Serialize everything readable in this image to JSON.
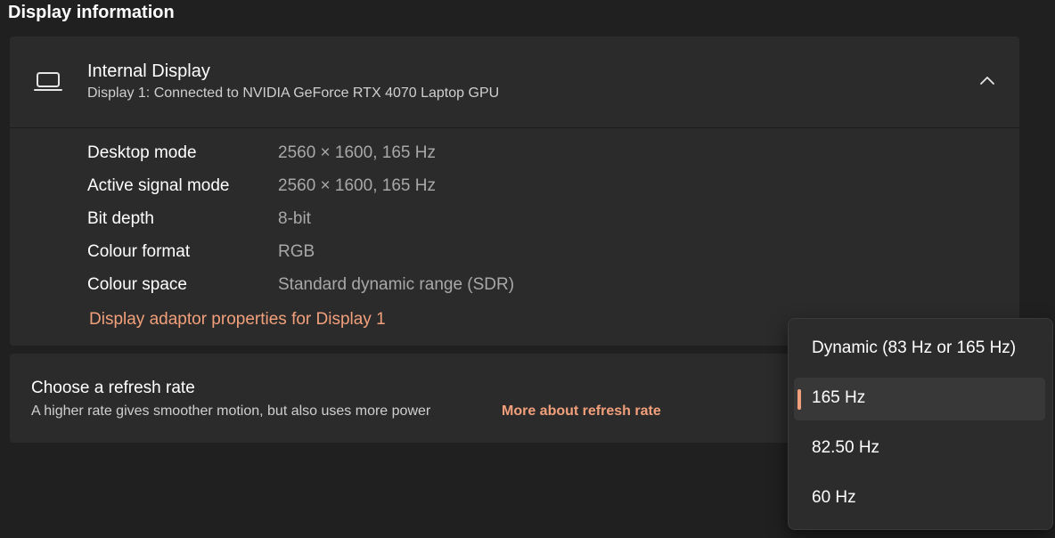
{
  "section": {
    "title": "Display information"
  },
  "display": {
    "title": "Internal Display",
    "subtitle": "Display 1: Connected to NVIDIA GeForce RTX 4070 Laptop GPU",
    "icon": "laptop-icon",
    "toggle_icon": "chevron-up-icon",
    "rows": [
      {
        "label": "Desktop mode",
        "value": "2560 × 1600, 165 Hz"
      },
      {
        "label": "Active signal mode",
        "value": "2560 × 1600, 165 Hz"
      },
      {
        "label": "Bit depth",
        "value": "8-bit"
      },
      {
        "label": "Colour format",
        "value": "RGB"
      },
      {
        "label": "Colour space",
        "value": "Standard dynamic range (SDR)"
      }
    ],
    "adapter_link": "Display adaptor properties for Display 1"
  },
  "refresh": {
    "title": "Choose a refresh rate",
    "description": "A higher rate gives smoother motion, but also uses more power",
    "link": "More about refresh rate",
    "selected": "165 Hz",
    "options": [
      {
        "label": "Dynamic (83 Hz or 165 Hz)"
      },
      {
        "label": "165 Hz"
      },
      {
        "label": "82.50 Hz"
      },
      {
        "label": "60 Hz"
      }
    ]
  },
  "colors": {
    "accent": "#f2a07b",
    "background": "#202020",
    "card": "#2b2b2b"
  }
}
